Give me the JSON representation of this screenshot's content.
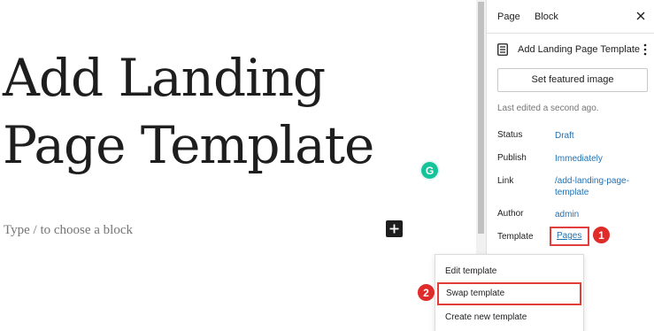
{
  "editor": {
    "title_line1": "Add Landing",
    "title_line2": "Page Template",
    "placeholder": "Type / to choose a block",
    "add_block_symbol": "+",
    "grammarly_letter": "G"
  },
  "sidebar": {
    "tabs": [
      {
        "label": "Page",
        "active": true
      },
      {
        "label": "Block",
        "active": false
      }
    ],
    "close_icon": "close-icon",
    "panel_title": "Add Landing Page Template",
    "featured_image_label": "Set featured image",
    "last_edited": "Last edited a second ago.",
    "rows": {
      "status": {
        "label": "Status",
        "value": "Draft"
      },
      "publish": {
        "label": "Publish",
        "value": "Immediately"
      },
      "link": {
        "label": "Link",
        "value_line1": "/add-landing-page-",
        "value_line2": "template"
      },
      "author": {
        "label": "Author",
        "value": "admin"
      },
      "template": {
        "label": "Template",
        "value": "Pages"
      }
    }
  },
  "dropdown": {
    "items": [
      "Edit template",
      "Swap template",
      "Create new template"
    ]
  },
  "callouts": [
    "1",
    "2"
  ],
  "colors": {
    "link": "#2271b1",
    "highlight": "#e23e3e",
    "callout": "#e02b2b",
    "grammarly": "#15c39a"
  }
}
